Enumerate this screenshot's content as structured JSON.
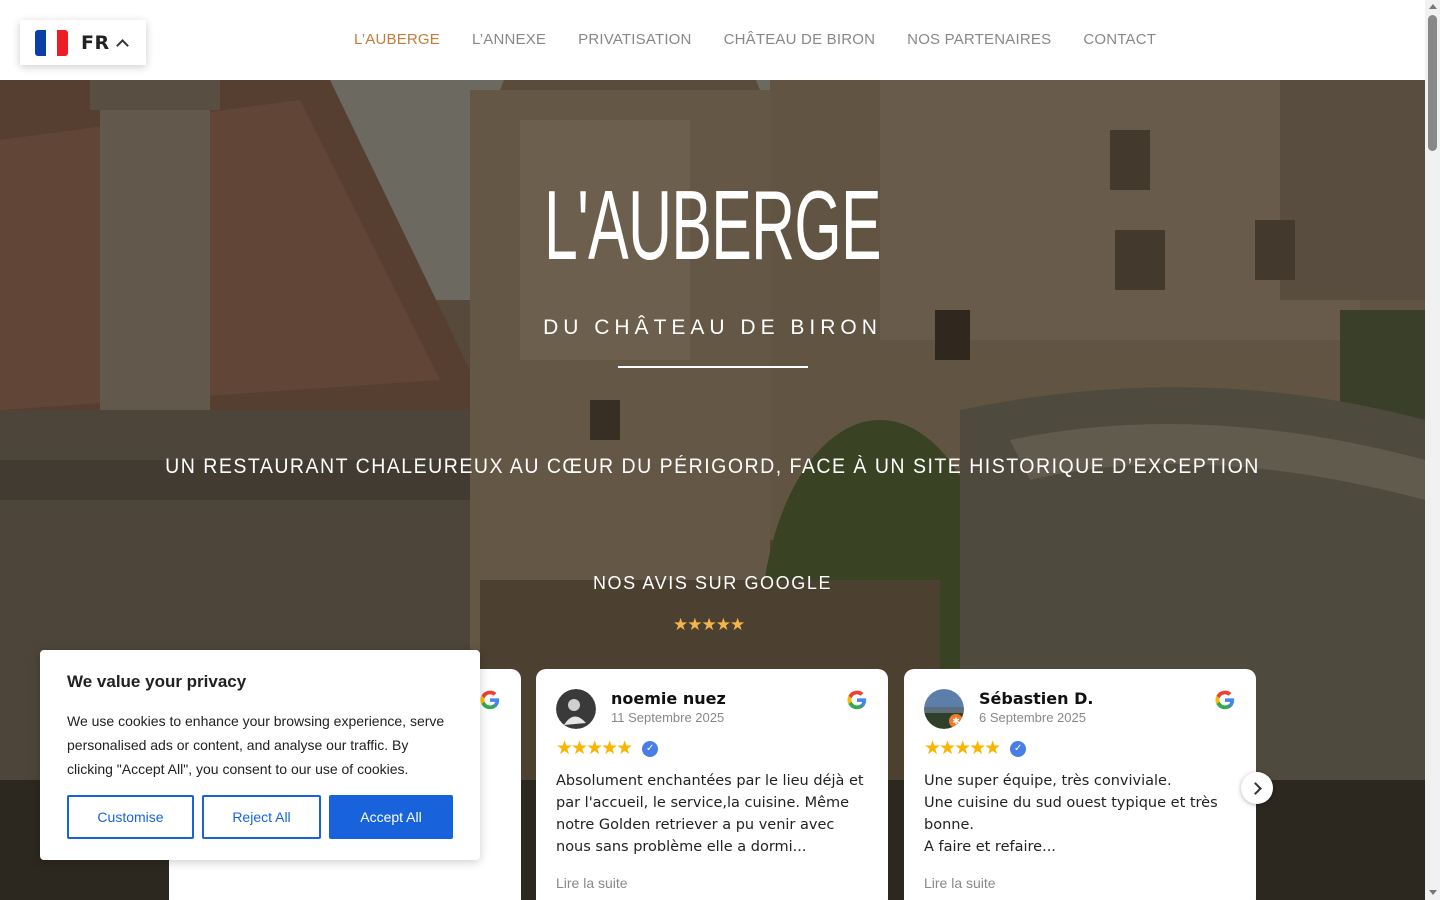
{
  "language": {
    "code": "FR",
    "flag_colors": [
      "#0b3fa8",
      "#ffffff",
      "#ee1c25"
    ]
  },
  "nav": {
    "items": [
      {
        "label": "L’AUBERGE",
        "active": true
      },
      {
        "label": "L’ANNEXE",
        "active": false
      },
      {
        "label": "PRIVATISATION",
        "active": false
      },
      {
        "label": "CHÂTEAU DE BIRON",
        "active": false
      },
      {
        "label": "NOS PARTENAIRES",
        "active": false
      },
      {
        "label": "CONTACT",
        "active": false
      }
    ]
  },
  "hero": {
    "title": "L'AUBERGE",
    "subtitle": "DU CHÂTEAU DE BIRON",
    "tagline": "UN RESTAURANT CHALEUREUX AU CŒUR DU PÉRIGORD, FACE À UN SITE HISTORIQUE D’EXCEPTION",
    "reviews_heading": "NOS AVIS SUR GOOGLE",
    "overall_rating": "★★★★★"
  },
  "reviews": [
    {
      "name": "noemie nuez",
      "date": "11 Septembre 2025",
      "stars": "★★★★★",
      "text": "Absolument enchantées par le lieu déjà et par l'accueil, le service,la cuisine. Même notre Golden retriever a pu venir avec nous sans problème elle a dormi...",
      "read_more": "Lire la suite"
    },
    {
      "name": "Sébastien D.",
      "date": "6 Septembre 2025",
      "stars": "★★★★★",
      "text": "Une super équipe, très conviviale.\nUne cuisine du sud ouest typique et très bonne.\nA faire et refaire...",
      "read_more": "Lire la suite"
    }
  ],
  "cookie": {
    "title": "We value your privacy",
    "text": "We use cookies to enhance your browsing experience, serve personalised ads or content, and analyse our traffic. By clicking \"Accept All\", you consent to our use of cookies.",
    "customise": "Customise",
    "reject": "Reject All",
    "accept": "Accept All"
  },
  "colors": {
    "accent": "#c27c3b",
    "cookie_blue": "#1863dc",
    "star": "#f9b600"
  }
}
